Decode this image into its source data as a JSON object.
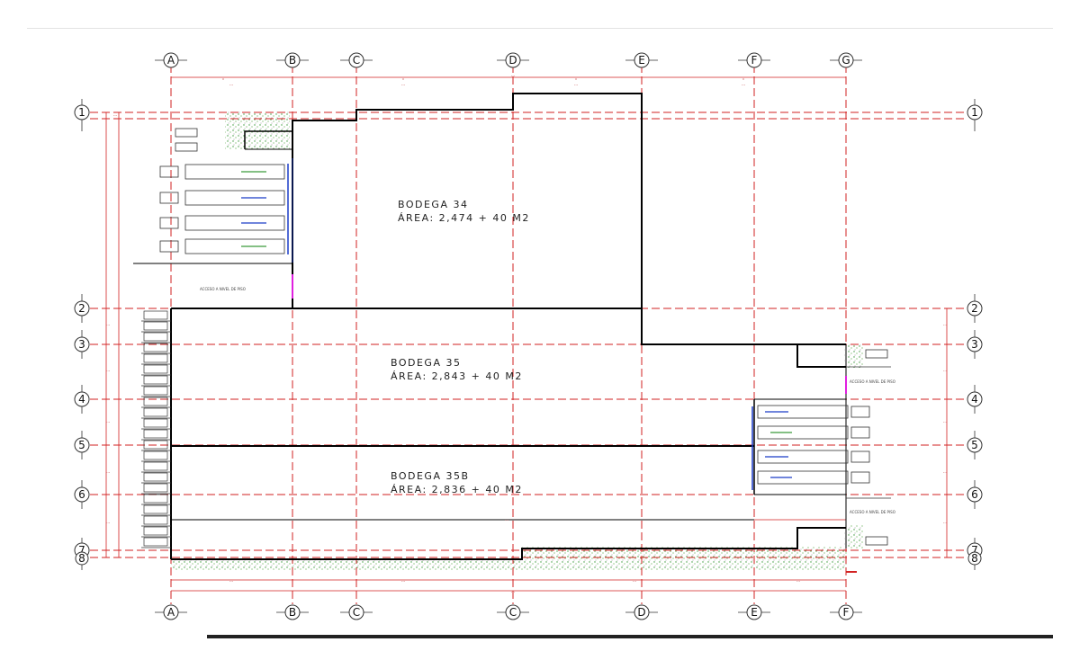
{
  "grid": {
    "top_columns": [
      "A",
      "B",
      "C",
      "D",
      "E",
      "F",
      "G"
    ],
    "bottom_columns": [
      "A",
      "B",
      "C",
      "C",
      "D",
      "E",
      "F"
    ],
    "left_rows": [
      "1",
      "2",
      "3",
      "4",
      "5",
      "6",
      "7",
      "8"
    ],
    "right_rows": [
      "1",
      "2",
      "3",
      "4",
      "5",
      "6",
      "7",
      "8"
    ]
  },
  "warehouses": [
    {
      "name": "BODEGA 34",
      "area": "ÁREA: 2,474 + 40  M2"
    },
    {
      "name": "BODEGA 35",
      "area": "ÁREA: 2,843 + 40  M2"
    },
    {
      "name": "BODEGA 35B",
      "area": "ÁREA: 2,836 + 40  M2"
    }
  ],
  "access_labels": {
    "left": "ACCESO A NIVEL DE PISO",
    "right_upper": "ACCESO A NIVEL DE PISO",
    "right_lower": "ACCESO A NIVEL DE PISO"
  },
  "colors": {
    "gridline": "#d22222",
    "wall": "#000000",
    "landscape": "#3a9a3a",
    "loading_dock": "#1a3cc8",
    "marker": "#e020e0"
  }
}
